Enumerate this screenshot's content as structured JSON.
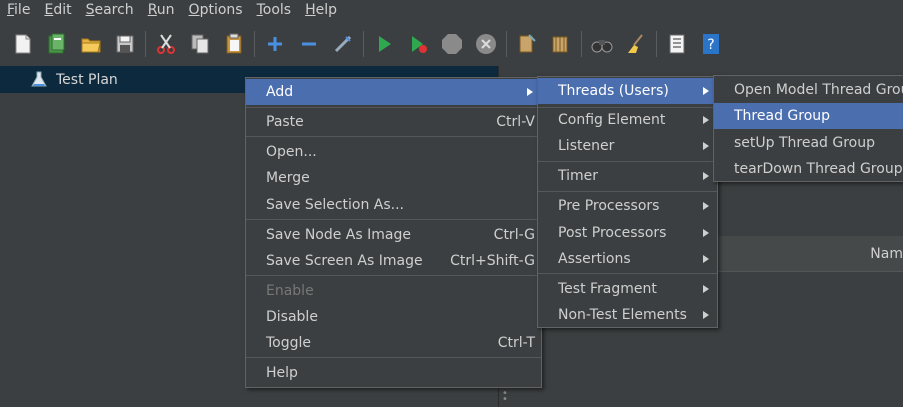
{
  "menubar": {
    "items": [
      {
        "first": "F",
        "rest": "ile"
      },
      {
        "first": "E",
        "rest": "dit"
      },
      {
        "first": "S",
        "rest": "earch"
      },
      {
        "first": "R",
        "rest": "un"
      },
      {
        "first": "O",
        "rest": "ptions"
      },
      {
        "first": "T",
        "rest": "ools"
      },
      {
        "first": "H",
        "rest": "elp"
      }
    ]
  },
  "tree": {
    "root_label": "Test Plan"
  },
  "right_panel": {
    "column_header_partial": "Nam"
  },
  "context_menu": {
    "add": "Add",
    "paste": "Paste",
    "paste_shortcut": "Ctrl-V",
    "open": "Open...",
    "merge": "Merge",
    "save_selection_as": "Save Selection As...",
    "save_node_as_image": "Save Node As Image",
    "save_node_shortcut": "Ctrl-G",
    "save_screen_as_image": "Save Screen As Image",
    "save_screen_shortcut": "Ctrl+Shift-G",
    "enable": "Enable",
    "disable": "Disable",
    "toggle": "Toggle",
    "toggle_shortcut": "Ctrl-T",
    "help": "Help"
  },
  "add_submenu": {
    "threads": "Threads (Users)",
    "config_element": "Config Element",
    "listener": "Listener",
    "timer": "Timer",
    "pre_processors": "Pre Processors",
    "post_processors": "Post Processors",
    "assertions": "Assertions",
    "test_fragment": "Test Fragment",
    "non_test_elements": "Non-Test Elements"
  },
  "threads_submenu": {
    "open_model": "Open Model Thread Group",
    "thread_group": "Thread Group",
    "setup": "setUp Thread Group",
    "teardown": "tearDown Thread Group"
  },
  "colors": {
    "background": "#3c3f41",
    "selection": "#4b6eaf",
    "tree_selection": "#0d293e"
  }
}
